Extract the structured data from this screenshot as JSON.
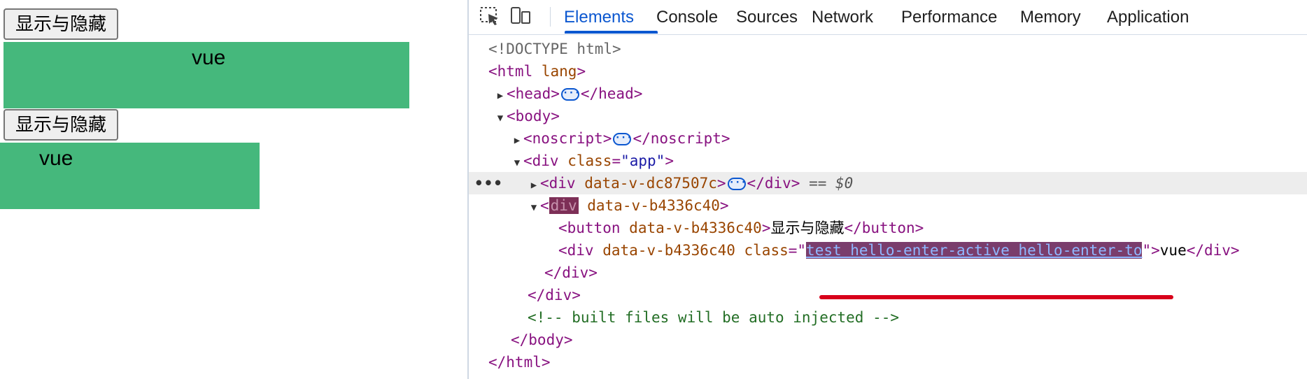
{
  "demo": {
    "button1_label": "显示与隐藏",
    "box1_text": "vue",
    "button2_label": "显示与隐藏",
    "box2_text": "vue",
    "box_color": "#45b87c"
  },
  "devtools": {
    "tabs": [
      "Elements",
      "Console",
      "Sources",
      "Network",
      "Performance",
      "Memory",
      "Application"
    ],
    "active_tab": "Elements",
    "icons": [
      "inspect-element-icon",
      "device-toolbar-icon"
    ],
    "accent_color": "#0b57d0",
    "tree": {
      "doctype": "<!DOCTYPE html>",
      "html_open": "<html",
      "html_attr": "lang",
      "head_open": "<head>",
      "head_close": "</head>",
      "body_open": "<body>",
      "noscript_open": "<noscript>",
      "noscript_close": "</noscript>",
      "div_app_open": "<div",
      "div_app_attr": "class",
      "div_app_val": "\"app\"",
      "div1_open": "<div",
      "div1_attr": "data-v-dc87507c",
      "div1_close": "</div>",
      "sel_marker": "== $0",
      "div2_lt": "<",
      "div2_tag": "div",
      "div2_attr": "data-v-b4336c40",
      "div2_gt": ">",
      "button_open": "<button",
      "button_attr": "data-v-b4336c40",
      "button_text": "显示与隐藏",
      "button_close": "</button>",
      "inner_div_open": "<div",
      "inner_div_attr": "data-v-b4336c40 class",
      "inner_div_class": "test hello-enter-active hello-enter-to",
      "inner_div_text": "vue",
      "inner_div_close": "</div>",
      "div2_close": "</div>",
      "div_app_close": "</div>",
      "comment": "<!-- built files will be auto injected -->",
      "body_close": "</body>",
      "html_close": "</html>"
    }
  }
}
